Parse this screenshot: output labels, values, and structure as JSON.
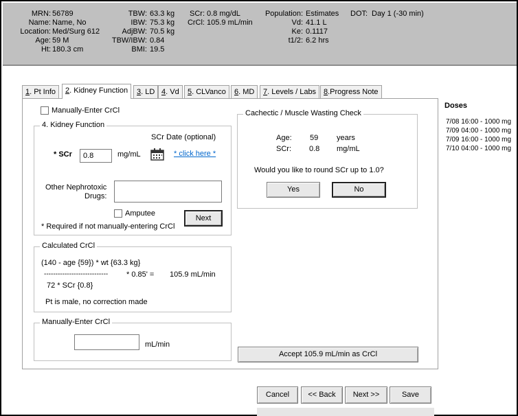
{
  "header": {
    "left_labels": [
      "MRN:",
      "Name:",
      "Location:",
      "Age:",
      "Ht:"
    ],
    "left_values": [
      "56789",
      "Name, No",
      "Med/Surg 612",
      "59 M",
      "180.3 cm"
    ],
    "mid_labels": [
      "TBW:",
      "IBW:",
      "AdjBW:",
      "TBW/IBW:",
      "BMI:"
    ],
    "mid_values": [
      "63.3 kg",
      "75.3 kg",
      "70.5 kg",
      "0.84",
      "19.5"
    ],
    "scr_labels": [
      "SCr:",
      "CrCl:"
    ],
    "scr_values": [
      "0.8 mg/dL",
      "105.9 mL/min"
    ],
    "pop_labels": [
      "Population:",
      "Vd:",
      "Ke:",
      "t1/2:"
    ],
    "pop_values": [
      "Estimates",
      "41.1 L",
      "0.1117",
      "6.2 hrs"
    ],
    "dot_label": "DOT:",
    "dot_value": "Day 1 (-30 min)"
  },
  "tabs": [
    {
      "num": "1",
      "label": ". Pt Info"
    },
    {
      "num": "2",
      "label": ". Kidney Function"
    },
    {
      "num": "3",
      "label": ". LD"
    },
    {
      "num": "4",
      "label": ". Vd"
    },
    {
      "num": "5",
      "label": ". CLVanco"
    },
    {
      "num": "6",
      "label": ". MD"
    },
    {
      "num": "7",
      "label": ". Levels / Labs"
    },
    {
      "num": "8",
      "label": ".Progress Note"
    }
  ],
  "kidney": {
    "manual_checkbox_label": "Manually-Enter CrCl",
    "group_title": "4. Kidney Function",
    "scr_label": "* SCr",
    "scr_value": "0.8",
    "scr_unit": "mg/mL",
    "scr_date_label": "SCr Date (optional)",
    "scr_date_link": "* click here *",
    "nephrotoxic_label_1": "Other Nephrotoxic",
    "nephrotoxic_label_2": "Drugs:",
    "nephrotoxic_value": "",
    "amputee_label": "Amputee",
    "next_button": "Next",
    "required_note": "* Required if not manually-entering CrCl"
  },
  "calc": {
    "group_title": "Calculated CrCl",
    "line1": "(140 - age {59}) * wt {63.3 kg}",
    "dashes": "----------------------------",
    "factor": "* 0.85' =",
    "result": "105.9 mL/min",
    "denominator": "72 * SCr {0.8}",
    "note": "Pt is male, no correction made"
  },
  "manual": {
    "group_title": "Manually-Enter CrCl",
    "value": "",
    "unit": "mL/min"
  },
  "cachectic": {
    "group_title": "Cachectic / Muscle Wasting Check",
    "age_label": "Age:",
    "age_value": "59",
    "age_unit": "years",
    "scr_label": "SCr:",
    "scr_value": "0.8",
    "scr_unit": "mg/mL",
    "question": "Would you like to round SCr up to 1.0?",
    "yes": "Yes",
    "no": "No"
  },
  "accept_button": "Accept 105.9 mL/min as CrCl",
  "doses": {
    "title": "Doses",
    "items": [
      "7/08 16:00 - 1000 mg",
      "7/09 04:00 - 1000 mg",
      "7/09 16:00 - 1000 mg",
      "7/10 04:00 - 1000 mg"
    ]
  },
  "footer": {
    "cancel": "Cancel",
    "back": "<< Back",
    "next": "Next >>",
    "save": "Save"
  }
}
